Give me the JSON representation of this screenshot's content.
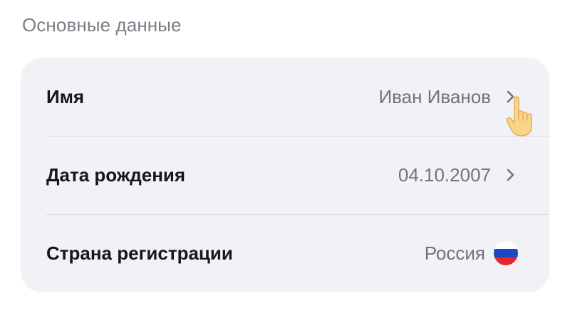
{
  "section": {
    "title": "Основные данные"
  },
  "rows": [
    {
      "label": "Имя",
      "value": "Иван Иванов",
      "trailing": "chevron-right-icon"
    },
    {
      "label": "Дата рождения",
      "value": "04.10.2007",
      "trailing": "chevron-right-icon"
    },
    {
      "label": "Страна регистрации",
      "value": "Россия",
      "trailing": "russia-flag-icon"
    }
  ],
  "colors": {
    "card_background": "#f1f2f6",
    "label_text": "#16171b",
    "value_text": "#70737c",
    "section_title": "#7b7d85",
    "chevron": "#70737c",
    "flag_white": "#ffffff",
    "flag_blue": "#1f47c4",
    "flag_red": "#e8262d"
  }
}
